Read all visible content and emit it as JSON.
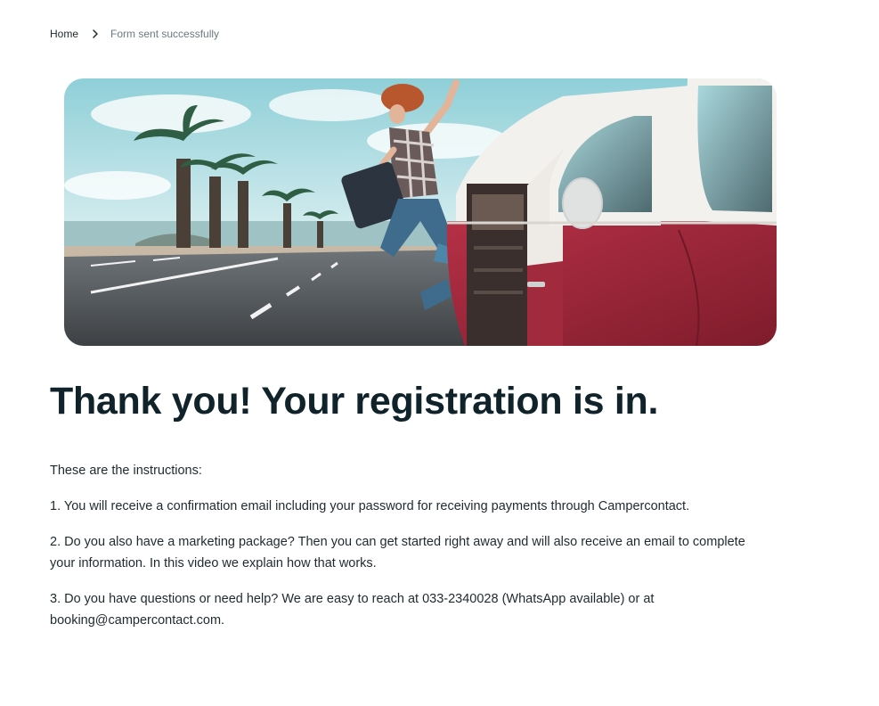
{
  "breadcrumb": {
    "home": "Home",
    "current": "Form sent successfully"
  },
  "hero": {
    "image_alt": "Woman jumping next to a red and white camper van on a palm-lined coastal road"
  },
  "page": {
    "title": "Thank you! Your registration is in.",
    "intro": "These are the instructions:",
    "steps": [
      "1. You will receive a confirmation email including your password for receiving payments through Campercontact.",
      "2. Do you also have a marketing package? Then you can get started right away and will also receive an email to complete your information. In this video we explain how that works.",
      "3. Do you have questions or need help? We are easy to reach at 033-2340028 (WhatsApp available) or at booking@campercontact.com."
    ]
  },
  "colors": {
    "title": "#11232a",
    "text": "#1f2a2e",
    "muted": "#6b7a80",
    "van_red": "#a8283a",
    "sky": "#bfe3e6"
  }
}
